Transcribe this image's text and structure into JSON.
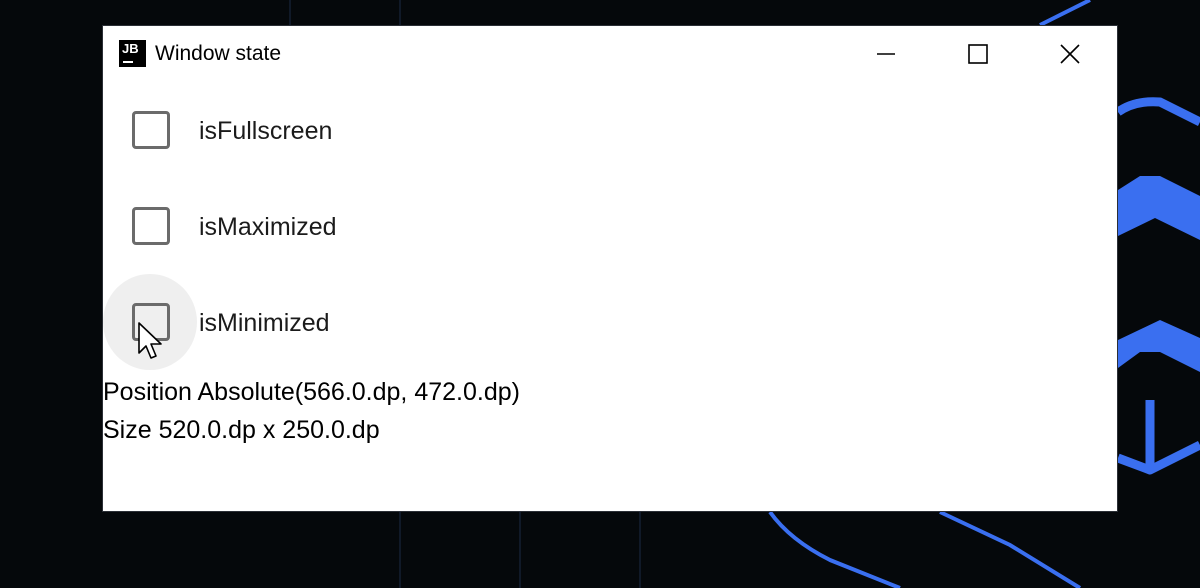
{
  "window": {
    "title": "Window state",
    "logo_text": "JB",
    "controls": {
      "minimize_icon": "minimize-icon",
      "maximize_icon": "maximize-icon",
      "close_icon": "close-icon"
    }
  },
  "checkboxes": [
    {
      "label": "isFullscreen",
      "checked": false
    },
    {
      "label": "isMaximized",
      "checked": false
    },
    {
      "label": "isMinimized",
      "checked": false
    }
  ],
  "info": {
    "position": "Position Absolute(566.0.dp, 472.0.dp)",
    "size": "Size 520.0.dp x 250.0.dp"
  },
  "colors": {
    "accent_wallpaper": "#3a6ff0",
    "checkbox_border": "#6b6b6b",
    "window_background": "#ffffff",
    "desktop_background": "#05080b"
  }
}
